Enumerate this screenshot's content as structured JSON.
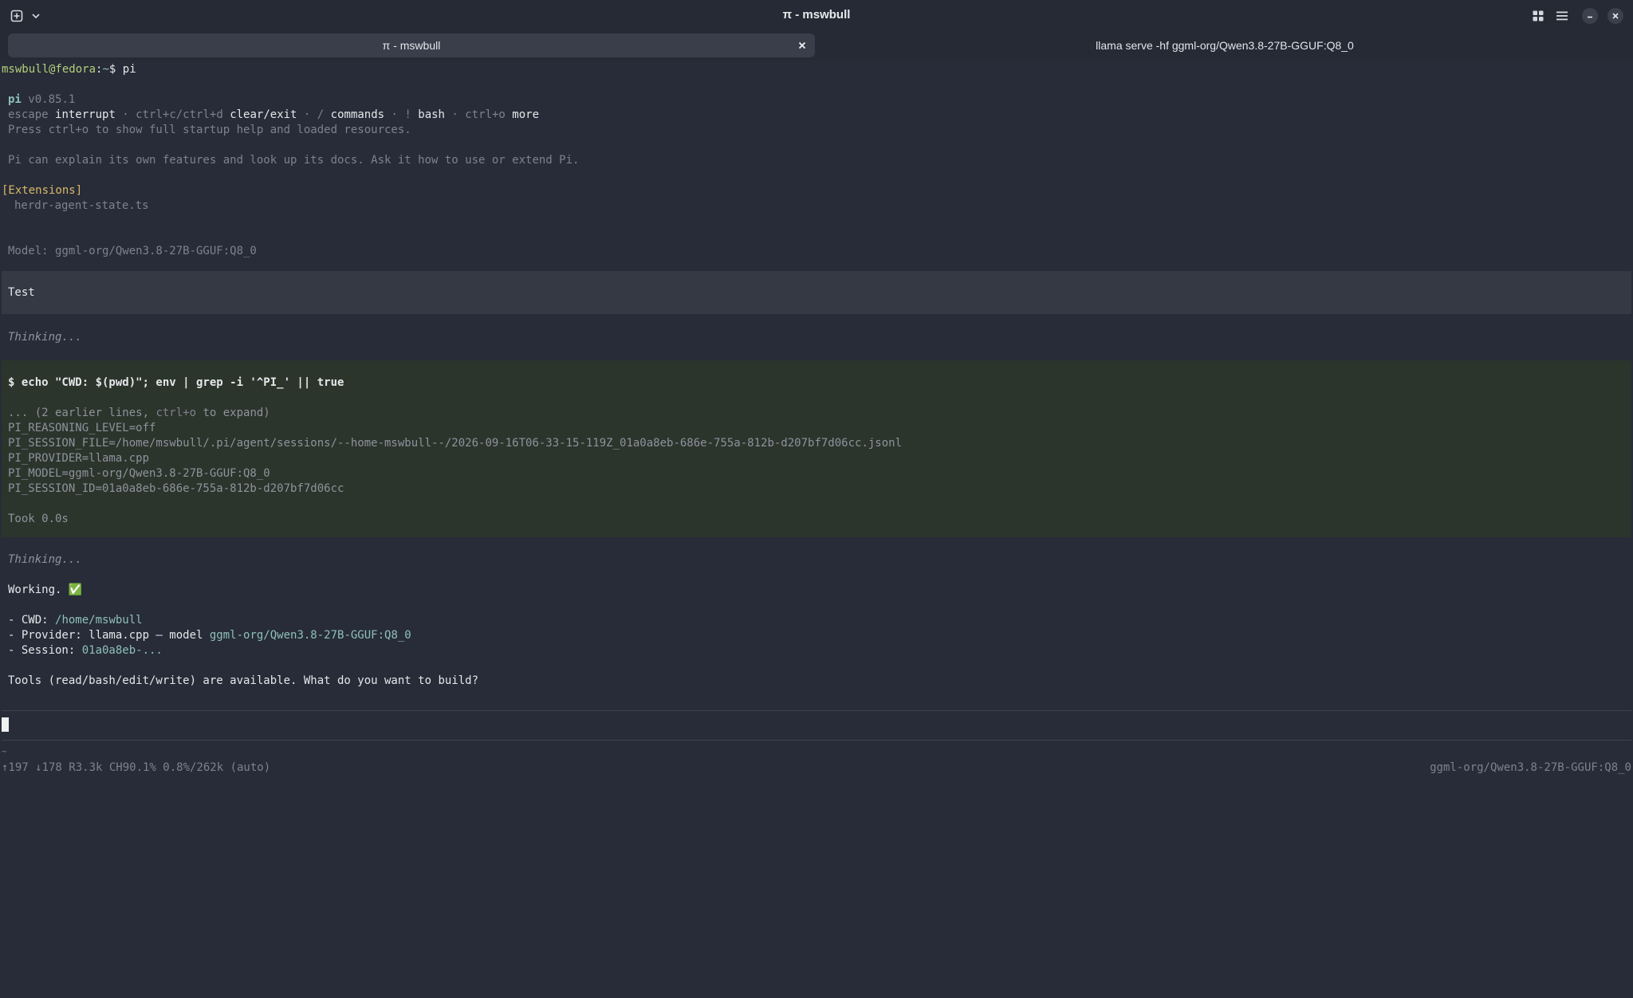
{
  "window": {
    "title": "π - mswbull",
    "icons": {
      "new_tab": "new-tab-icon",
      "new_tab_menu": "chevron-down-icon",
      "layout": "grid-icon",
      "menu": "hamburger-menu-icon",
      "minimize": "minimize-icon",
      "close": "close-icon"
    }
  },
  "tabs": [
    {
      "label": "π - mswbull",
      "active": true
    },
    {
      "label": "llama serve -hf ggml-org/Qwen3.8-27B-GGUF:Q8_0",
      "active": false
    }
  ],
  "terminal": {
    "prompt": {
      "user_host": "mswbull@fedora",
      "sep": ":",
      "path": "~",
      "symbol": "$",
      "command": "pi"
    },
    "header": {
      "name": "pi",
      "version": "v0.85.1",
      "keys": [
        {
          "key": "escape",
          "action": "interrupt"
        },
        {
          "key": "ctrl+c/ctrl+d",
          "action": "clear/exit"
        },
        {
          "key": "/",
          "action": "commands"
        },
        {
          "key": "!",
          "action": "bash"
        },
        {
          "key": "ctrl+o",
          "action": "more"
        }
      ],
      "separator": " · ",
      "help_line": "Press ctrl+o to show full startup help and loaded resources.",
      "intro_line": "Pi can explain its own features and look up its docs. Ask it how to use or extend Pi."
    },
    "extensions": {
      "title": "[Extensions]",
      "items": [
        "herdr-agent-state.ts"
      ]
    },
    "model_line": "Model: ggml-org/Qwen3.8-27B-GGUF:Q8_0",
    "user_message": "Test",
    "thinking_1": "Thinking...",
    "bash": {
      "command": "$ echo \"CWD: $(pwd)\"; env | grep -i '^PI_' || true",
      "collapsed_prefix": "... (2 earlier lines, ",
      "collapsed_key": "ctrl+o",
      "collapsed_suffix": " to expand)",
      "output": [
        "PI_REASONING_LEVEL=off",
        "PI_SESSION_FILE=/home/mswbull/.pi/agent/sessions/--home-mswbull--/2026-09-16T06-33-15-119Z_01a0a8eb-686e-755a-812b-d207bf7d06cc.jsonl",
        "PI_PROVIDER=llama.cpp",
        "PI_MODEL=ggml-org/Qwen3.8-27B-GGUF:Q8_0",
        "PI_SESSION_ID=01a0a8eb-686e-755a-812b-d207bf7d06cc"
      ],
      "took": "Took 0.0s"
    },
    "thinking_2": "Thinking...",
    "response": {
      "working": "Working. ✅",
      "cwd_label": "- CWD: ",
      "cwd_value": "/home/mswbull",
      "provider_label": "- Provider: llama.cpp — model ",
      "provider_value": "ggml-org/Qwen3.8-27B-GGUF:Q8_0",
      "session_label": "- Session: ",
      "session_value": "01a0a8eb-...",
      "tools_line": "Tools (read/bash/edit/write) are available. What do you want to build?"
    },
    "status": {
      "tilde": "~",
      "stats": "↑197 ↓178 R3.3k CH90.1% 0.8%/262k (auto)",
      "model": "ggml-org/Qwen3.8-27B-GGUF:Q8_0"
    }
  },
  "colors": {
    "background": "#272c38",
    "user_block": "#343944",
    "bash_block": "#2b352c",
    "prompt_green": "#b5cf7a",
    "accent_teal": "#8fc0b8",
    "extension_yellow": "#dbb867"
  }
}
